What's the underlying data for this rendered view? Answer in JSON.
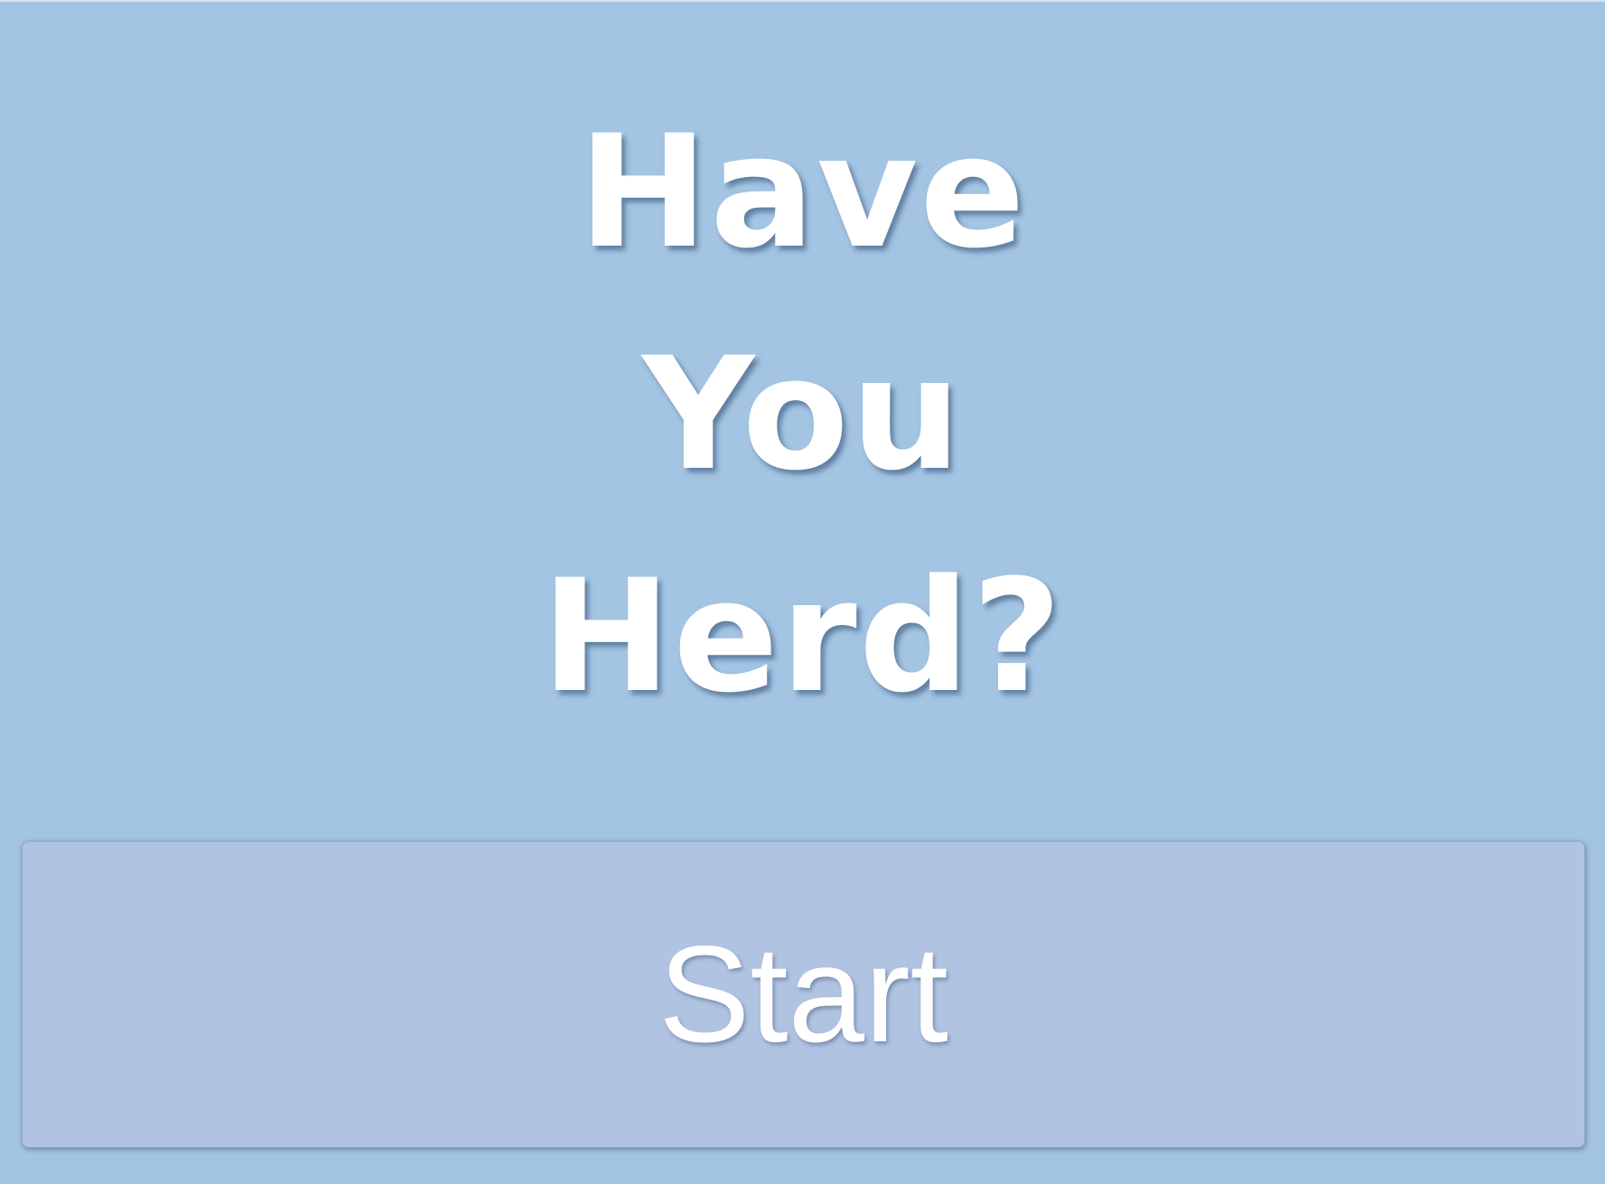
{
  "colors": {
    "background": "#a3c4e2",
    "button_background": "#b0c4e2",
    "text": "#ffffff"
  },
  "title": {
    "lines": [
      "Have",
      "You",
      "Herd?"
    ]
  },
  "start_button": {
    "label": "Start"
  }
}
